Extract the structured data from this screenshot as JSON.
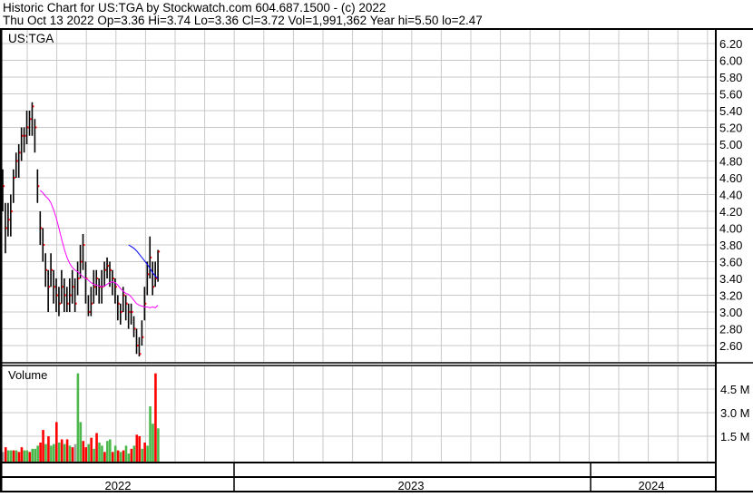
{
  "header": {
    "line1": "Historic Chart for US:TGA by Stockwatch.com 604.687.1500 - (c) 2022",
    "line2": "Thu Oct 13 2022  Op=3.36  Hi=3.74  Lo=3.36  Cl=3.72  Vol=1,991,362  Year hi=5.50  lo=2.47"
  },
  "symbol_label": "US:TGA",
  "volume_label": "Volume",
  "colors": {
    "bar": "#000000",
    "close_tick": "#ff0000",
    "ma_long": "#ff00ff",
    "ma_short": "#0000ff",
    "vol_up": "#4cb84c",
    "vol_down": "#ff0000",
    "vol_flat": "#a0a0a0",
    "grid": "#c8c8c8"
  },
  "chart_data": [
    {
      "type": "ohlc",
      "title": "US:TGA",
      "yticks": [
        "6.20",
        "6.00",
        "5.80",
        "5.60",
        "5.40",
        "5.20",
        "5.00",
        "4.80",
        "4.60",
        "4.40",
        "4.20",
        "4.00",
        "3.80",
        "3.60",
        "3.40",
        "3.20",
        "3.00",
        "2.80",
        "2.60"
      ],
      "ylim": [
        2.45,
        6.3
      ],
      "bars_hlc": [
        [
          4.7,
          4.2,
          4.5
        ],
        [
          4.3,
          3.7,
          4.0
        ],
        [
          4.3,
          3.9,
          4.1
        ],
        [
          4.4,
          3.9,
          4.2
        ],
        [
          4.7,
          4.3,
          4.6
        ],
        [
          4.9,
          4.6,
          4.8
        ],
        [
          5.0,
          4.6,
          4.9
        ],
        [
          5.2,
          4.8,
          5.1
        ],
        [
          5.2,
          4.9,
          5.1
        ],
        [
          5.4,
          5.0,
          5.2
        ],
        [
          5.4,
          5.1,
          5.3
        ],
        [
          5.5,
          5.1,
          5.45
        ],
        [
          5.3,
          4.9,
          5.2
        ],
        [
          4.7,
          4.3,
          4.5
        ],
        [
          4.2,
          3.8,
          4.0
        ],
        [
          4.0,
          3.6,
          3.8
        ],
        [
          3.7,
          3.3,
          3.5
        ],
        [
          3.5,
          3.0,
          3.3
        ],
        [
          3.7,
          3.3,
          3.5
        ],
        [
          3.5,
          3.1,
          3.3
        ],
        [
          3.4,
          3.0,
          3.2
        ],
        [
          3.3,
          2.95,
          3.1
        ],
        [
          3.5,
          3.1,
          3.3
        ],
        [
          3.4,
          3.0,
          3.2
        ],
        [
          3.3,
          3.0,
          3.1
        ],
        [
          3.4,
          3.0,
          3.2
        ],
        [
          3.5,
          3.1,
          3.3
        ],
        [
          3.4,
          3.0,
          3.1
        ],
        [
          3.6,
          3.2,
          3.4
        ],
        [
          3.8,
          3.4,
          3.6
        ],
        [
          3.93,
          3.5,
          3.8
        ],
        [
          3.6,
          3.1,
          3.4
        ],
        [
          3.2,
          2.95,
          3.0
        ],
        [
          3.3,
          2.95,
          3.1
        ],
        [
          3.5,
          3.1,
          3.3
        ],
        [
          3.5,
          3.2,
          3.4
        ],
        [
          3.4,
          3.1,
          3.3
        ],
        [
          3.5,
          3.1,
          3.3
        ],
        [
          3.6,
          3.3,
          3.5
        ],
        [
          3.65,
          3.4,
          3.55
        ],
        [
          3.6,
          3.3,
          3.5
        ],
        [
          3.5,
          3.2,
          3.4
        ],
        [
          3.4,
          3.1,
          3.3
        ],
        [
          3.2,
          2.9,
          3.1
        ],
        [
          3.1,
          2.85,
          3.0
        ],
        [
          3.3,
          3.0,
          3.2
        ],
        [
          3.2,
          2.9,
          3.1
        ],
        [
          3.1,
          2.8,
          3.0
        ],
        [
          3.1,
          2.85,
          3.0
        ],
        [
          2.95,
          2.7,
          2.8
        ],
        [
          2.8,
          2.5,
          2.6
        ],
        [
          2.7,
          2.47,
          2.5
        ],
        [
          2.9,
          2.6,
          2.7
        ],
        [
          3.3,
          2.9,
          3.1
        ],
        [
          3.6,
          3.2,
          3.45
        ],
        [
          3.9,
          3.4,
          3.65
        ],
        [
          3.6,
          3.2,
          3.3
        ],
        [
          3.6,
          3.3,
          3.4
        ],
        [
          3.74,
          3.36,
          3.72
        ]
      ],
      "ma_long": {
        "start_index": 14,
        "values": [
          4.45,
          4.42,
          4.38,
          4.35,
          4.3,
          4.22,
          4.12,
          4.0,
          3.87,
          3.75,
          3.65,
          3.58,
          3.53,
          3.5,
          3.48,
          3.45,
          3.42,
          3.4,
          3.38,
          3.35,
          3.33,
          3.32,
          3.31,
          3.3,
          3.31,
          3.33,
          3.35,
          3.36,
          3.35,
          3.32,
          3.28,
          3.25,
          3.22,
          3.21,
          3.18,
          3.14,
          3.1,
          3.08,
          3.07,
          3.06,
          3.06,
          3.05,
          3.06,
          3.05,
          3.08
        ]
      },
      "ma_short": {
        "start_index": 47,
        "values": [
          3.8,
          3.78,
          3.76,
          3.73,
          3.69,
          3.65,
          3.61,
          3.57,
          3.52,
          3.47,
          3.43,
          3.4
        ]
      }
    },
    {
      "type": "bar",
      "title": "Volume",
      "yticks": [
        "4.5 M",
        "3.0 M",
        "1.5 M"
      ],
      "unit": "M",
      "values": [
        0.5,
        0.8,
        0.6,
        0.6,
        0.6,
        0.6,
        0.5,
        0.8,
        0.6,
        0.6,
        0.5,
        0.7,
        0.7,
        0.9,
        1.1,
        1.9,
        1.0,
        1.5,
        0.9,
        1.0,
        2.4,
        1.1,
        1.3,
        1.0,
        1.3,
        0.9,
        0.8,
        1.0,
        5.5,
        2.4,
        1.2,
        0.8,
        1.0,
        1.4,
        0.7,
        1.7,
        1.1,
        0.9,
        0.5,
        1.2,
        1.3,
        0.5,
        0.9,
        0.6,
        0.5,
        0.6,
        0.9,
        0.4,
        0.7,
        0.9,
        1.6,
        1.5,
        0.7,
        1.1,
        0.9,
        3.4,
        2.3,
        5.5,
        2.0
      ],
      "direction": [
        "n",
        "d",
        "u",
        "u",
        "d",
        "u",
        "d",
        "d",
        "u",
        "u",
        "d",
        "u",
        "u",
        "u",
        "d",
        "d",
        "u",
        "d",
        "u",
        "u",
        "d",
        "u",
        "d",
        "u",
        "d",
        "u",
        "d",
        "n",
        "u",
        "u",
        "d",
        "d",
        "u",
        "d",
        "u",
        "d",
        "u",
        "u",
        "d",
        "u",
        "u",
        "d",
        "u",
        "d",
        "u",
        "d",
        "u",
        "u",
        "d",
        "u",
        "d",
        "d",
        "u",
        "d",
        "u",
        "u",
        "u",
        "d",
        "u"
      ],
      "ylim": [
        0,
        5.6
      ]
    }
  ],
  "time_axis": {
    "years": [
      "2022",
      "2023",
      "2024"
    ]
  }
}
